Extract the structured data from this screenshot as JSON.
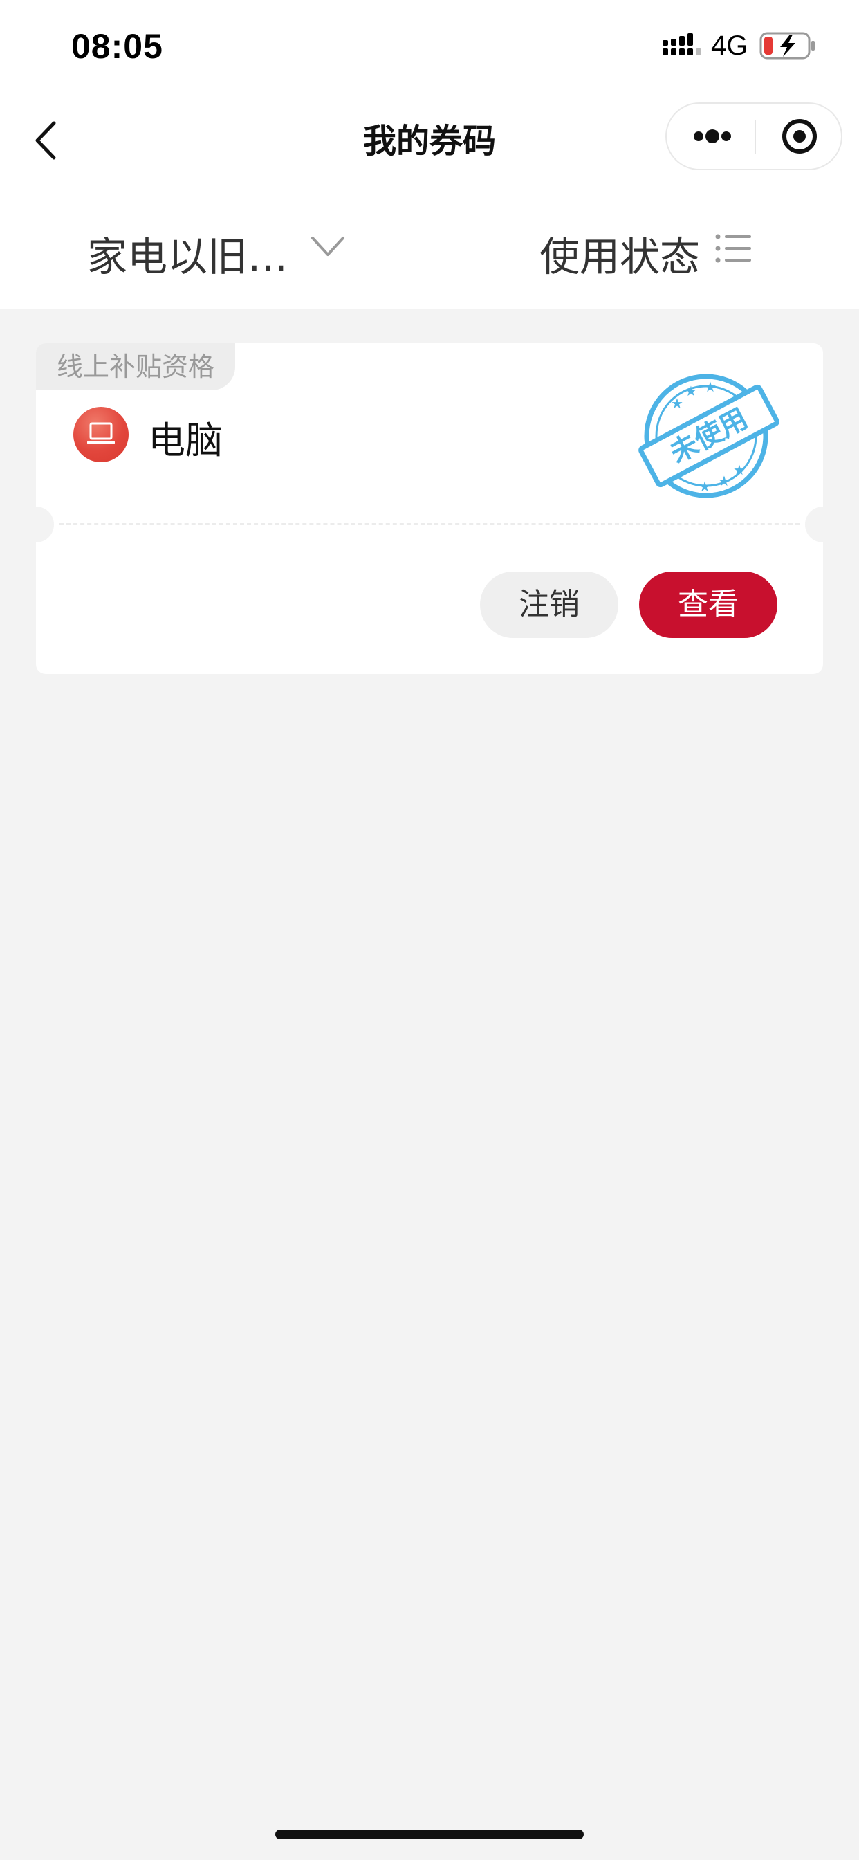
{
  "status_bar": {
    "time": "08:05",
    "network": "4G",
    "signal_icon": "signal-bars-icon",
    "battery_icon": "battery-charging-low-icon"
  },
  "nav": {
    "title": "我的券码",
    "back_icon": "chevron-left-icon",
    "more_icon": "more-dots-icon",
    "close_icon": "target-circle-icon"
  },
  "filters": {
    "category_label": "家电以旧…",
    "category_icon": "chevron-down-icon",
    "status_label": "使用状态",
    "status_icon": "list-icon"
  },
  "coupons": [
    {
      "tag": "线上补贴资格",
      "product_icon": "laptop-icon",
      "product_name": "电脑",
      "status": "未使用",
      "actions": {
        "cancel": "注销",
        "view": "查看"
      }
    }
  ],
  "colors": {
    "accent": "#c8102e",
    "stamp": "#4db3e6",
    "background": "#f3f3f3",
    "product_icon_bg": "#e2463c"
  }
}
